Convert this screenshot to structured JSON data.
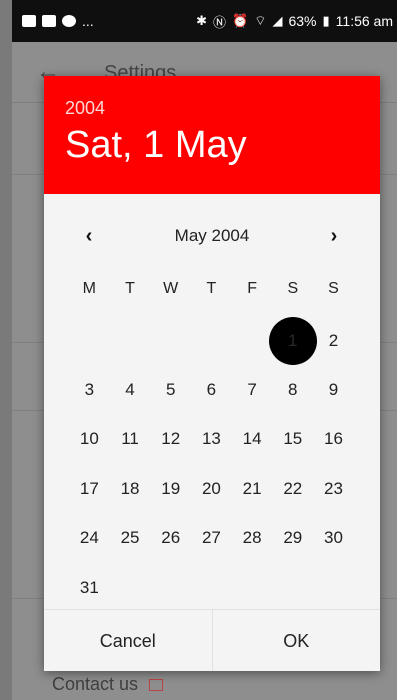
{
  "status_bar": {
    "left_text": "...",
    "battery": "63%",
    "time": "11:56 am"
  },
  "background": {
    "title": "Settings",
    "contact": "Contact us"
  },
  "dialog": {
    "year": "2004",
    "selected_date": "Sat, 1 May",
    "month_label": "May 2004",
    "weekdays": [
      "M",
      "T",
      "W",
      "T",
      "F",
      "S",
      "S"
    ],
    "leading_blanks": 5,
    "days": [
      "1",
      "2",
      "3",
      "4",
      "5",
      "6",
      "7",
      "8",
      "9",
      "10",
      "11",
      "12",
      "13",
      "14",
      "15",
      "16",
      "17",
      "18",
      "19",
      "20",
      "21",
      "22",
      "23",
      "24",
      "25",
      "26",
      "27",
      "28",
      "29",
      "30",
      "31"
    ],
    "selected_day": "1",
    "cancel_label": "Cancel",
    "ok_label": "OK"
  }
}
